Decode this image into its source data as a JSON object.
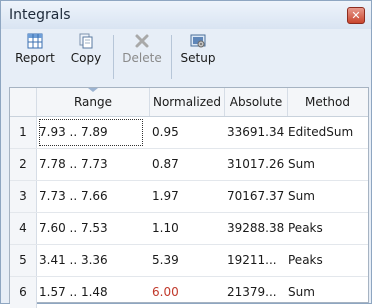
{
  "window": {
    "title": "Integrals",
    "close_glyph": "✕"
  },
  "toolbar": {
    "buttons": [
      {
        "label": "Report",
        "icon": "table-icon",
        "enabled": true
      },
      {
        "label": "Copy",
        "icon": "copy-icon",
        "enabled": true
      },
      {
        "label": "Delete",
        "icon": "delete-icon",
        "enabled": false
      },
      {
        "label": "Setup",
        "icon": "setup-icon",
        "enabled": true
      }
    ]
  },
  "table": {
    "columns": [
      "Range",
      "Normalized",
      "Absolute",
      "Method"
    ],
    "rows": [
      {
        "n": "1",
        "range": "7.93 .. 7.89",
        "normalized": "0.95",
        "absolute": "33691.34",
        "method": "EditedSum"
      },
      {
        "n": "2",
        "range": "7.78 .. 7.73",
        "normalized": "0.87",
        "absolute": "31017.26",
        "method": "Sum"
      },
      {
        "n": "3",
        "range": "7.73 .. 7.66",
        "normalized": "1.97",
        "absolute": "70167.37",
        "method": "Sum"
      },
      {
        "n": "4",
        "range": "7.60 .. 7.53",
        "normalized": "1.10",
        "absolute": "39288.38",
        "method": "Peaks"
      },
      {
        "n": "5",
        "range": "3.41 .. 3.36",
        "normalized": "5.39",
        "absolute": "19211...",
        "method": "Peaks"
      },
      {
        "n": "6",
        "range": "1.57 .. 1.48",
        "normalized": "6.00",
        "absolute": "21379...",
        "method": "Sum"
      }
    ]
  },
  "colors": {
    "highlight_value": "#c0392b"
  }
}
